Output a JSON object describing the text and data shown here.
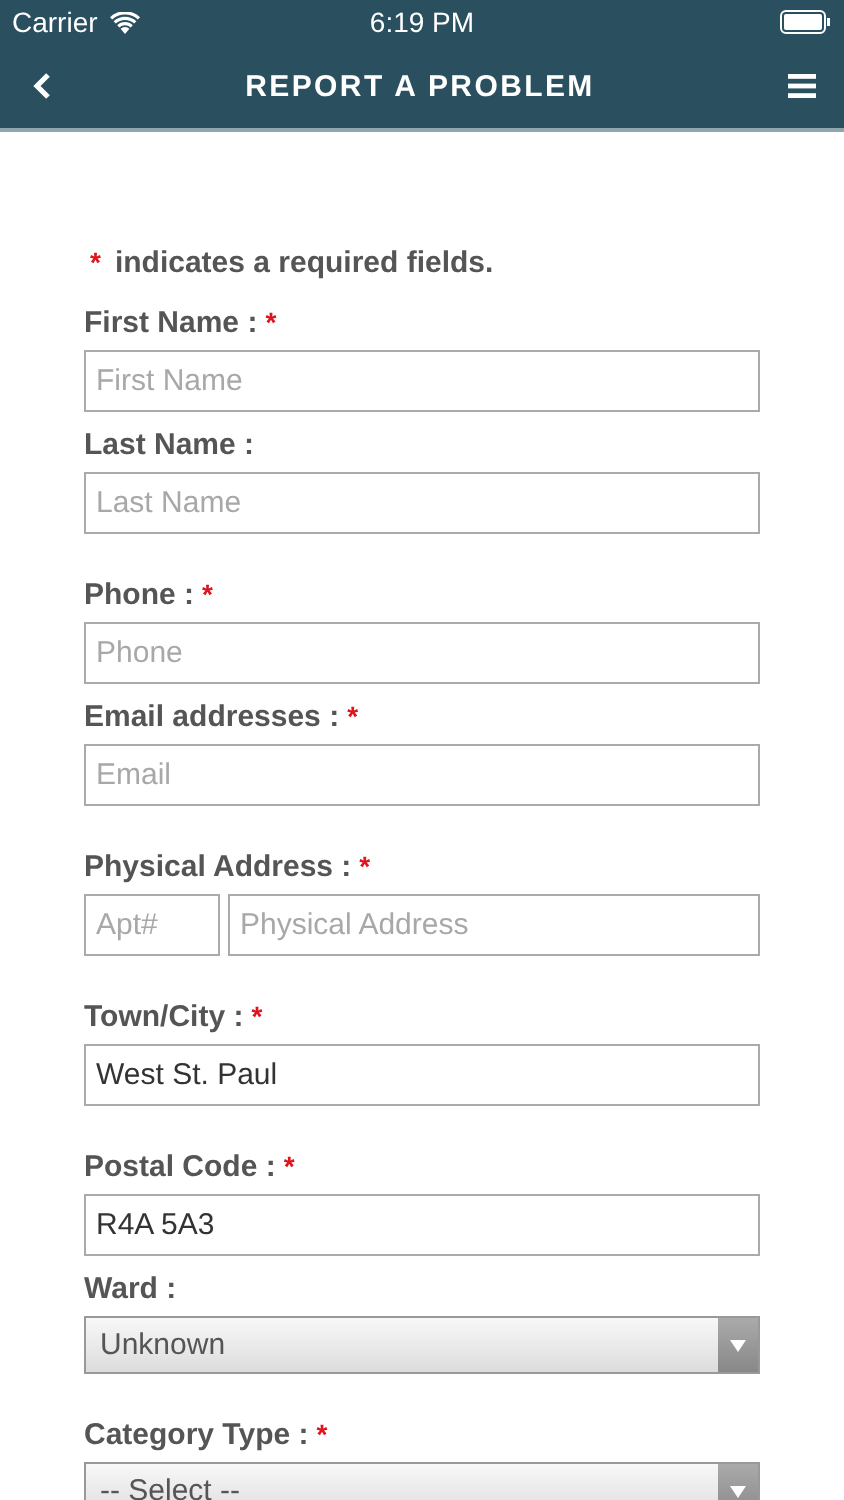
{
  "status_bar": {
    "carrier": "Carrier",
    "time": "6:19 PM"
  },
  "nav": {
    "title": "REPORT A PROBLEM"
  },
  "required_note": {
    "mark": "*",
    "text": "indicates a required fields."
  },
  "groups": [
    {
      "fields": [
        {
          "kind": "text",
          "label": "First Name :",
          "required": true,
          "placeholder": "First Name"
        },
        {
          "kind": "text",
          "label": "Last Name :",
          "required": false,
          "placeholder": "Last Name"
        }
      ]
    },
    {
      "fields": [
        {
          "kind": "text",
          "label": "Phone :",
          "required": true,
          "placeholder": "Phone"
        },
        {
          "kind": "text",
          "label": "Email addresses :",
          "required": true,
          "placeholder": "Email"
        }
      ]
    },
    {
      "fields": [
        {
          "kind": "address",
          "label": "Physical Address :",
          "required": true,
          "apt_placeholder": "Apt#",
          "placeholder": "Physical Address"
        }
      ]
    },
    {
      "fields": [
        {
          "kind": "text",
          "label": "Town/City :",
          "required": true,
          "value": "West St. Paul"
        }
      ]
    },
    {
      "fields": [
        {
          "kind": "text",
          "label": "Postal Code :",
          "required": true,
          "value": "R4A 5A3"
        },
        {
          "kind": "select",
          "label": "Ward :",
          "required": false,
          "value": "Unknown"
        }
      ]
    },
    {
      "fields": [
        {
          "kind": "select",
          "label": "Category Type :",
          "required": true,
          "value": "-- Select --"
        }
      ]
    }
  ]
}
